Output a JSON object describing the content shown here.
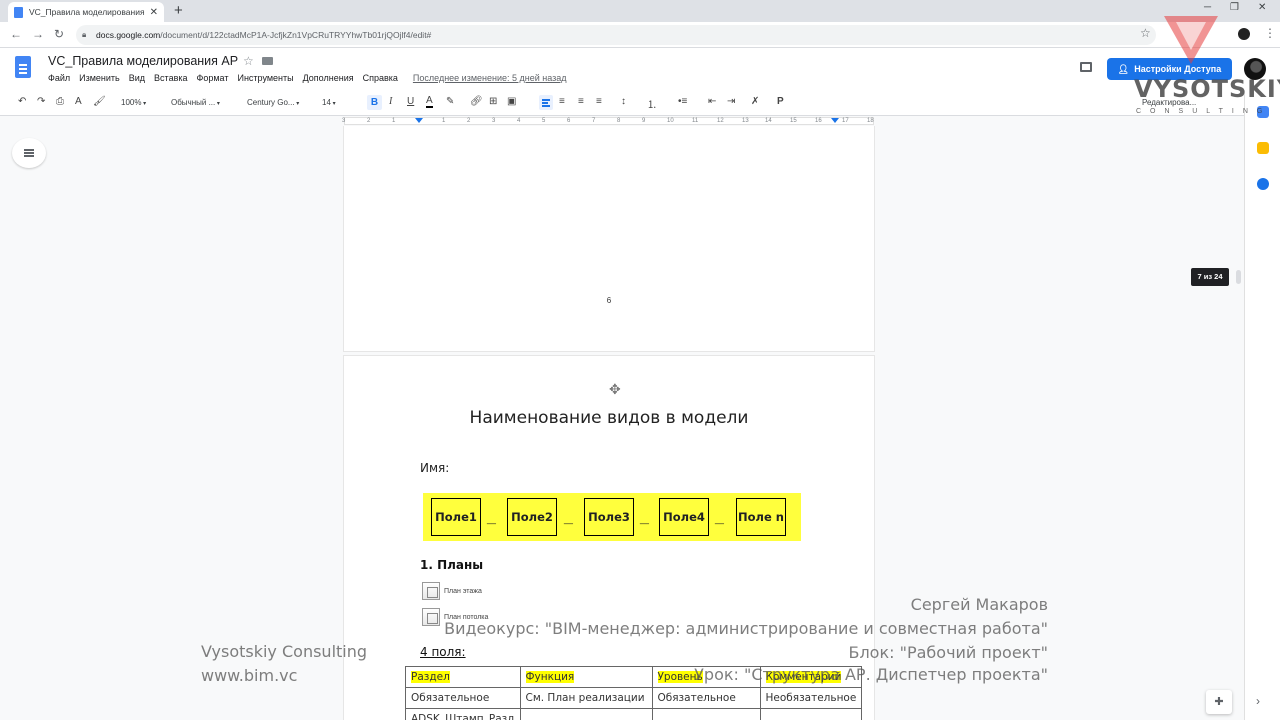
{
  "browser": {
    "tab_title": "VC_Правила моделирования АР - Go",
    "url_host": "docs.google.com",
    "url_path": "/document/d/122ctadMcP1A-JcfjkZn1VpCRuTRYYhwTb01rjQOjlf4/edit#"
  },
  "docs": {
    "title": "VC_Правила моделирования АР",
    "menu": [
      "Файл",
      "Изменить",
      "Вид",
      "Вставка",
      "Формат",
      "Инструменты",
      "Дополнения",
      "Справка"
    ],
    "last_edit": "Последнее изменение: 5 дней назад",
    "share_label": "Настройки Доступа"
  },
  "toolbar": {
    "zoom": "100%",
    "style": "Обычный ...",
    "font": "Century Go...",
    "size": "14",
    "mode": "Редактирова..."
  },
  "ruler": {
    "ticks": [
      "3",
      "2",
      "1",
      "1",
      "2",
      "3",
      "4",
      "5",
      "6",
      "7",
      "8",
      "9",
      "10",
      "11",
      "12",
      "13",
      "14",
      "15",
      "16",
      "17",
      "18"
    ]
  },
  "page_prev": {
    "number": "6"
  },
  "page": {
    "title": "Наименование видов в модели",
    "name_label": "Имя:",
    "fields": [
      "Поле1",
      "Поле2",
      "Поле3",
      "Поле4",
      "Поле n"
    ],
    "separator": "_",
    "section": "1. Планы",
    "plan_items": [
      "План этажа",
      "План потолка"
    ],
    "fields_count": "4 поля",
    "fields_count_suffix": ":",
    "table": {
      "header": [
        "Раздел",
        "Функция",
        "Уровень",
        "Комментарий"
      ],
      "rows": [
        [
          "Обязательное",
          "См. План реализации",
          "Обязательное",
          "Необязательное"
        ],
        [
          "ADSK_Штамп_Разд",
          "",
          "",
          ""
        ]
      ]
    }
  },
  "page_indicator": "7 из 24",
  "watermark": {
    "brand": "VYSOTSKIY",
    "brand_sub": "CONSULTING",
    "company": "Vysotskiy Consulting",
    "site": "www.bim.vc",
    "author": "Сергей Макаров",
    "course": "Видеокурс: \"BIM-менеджер: администрирование и совместная работа\"",
    "block": "Блок: \"Рабочий проект\"",
    "lesson": "Урок: \"Структура АР. Диспетчер проекта\""
  },
  "colors": {
    "accent": "#1a73e8",
    "highlight": "#ffff00",
    "band": "#ffff3d"
  }
}
